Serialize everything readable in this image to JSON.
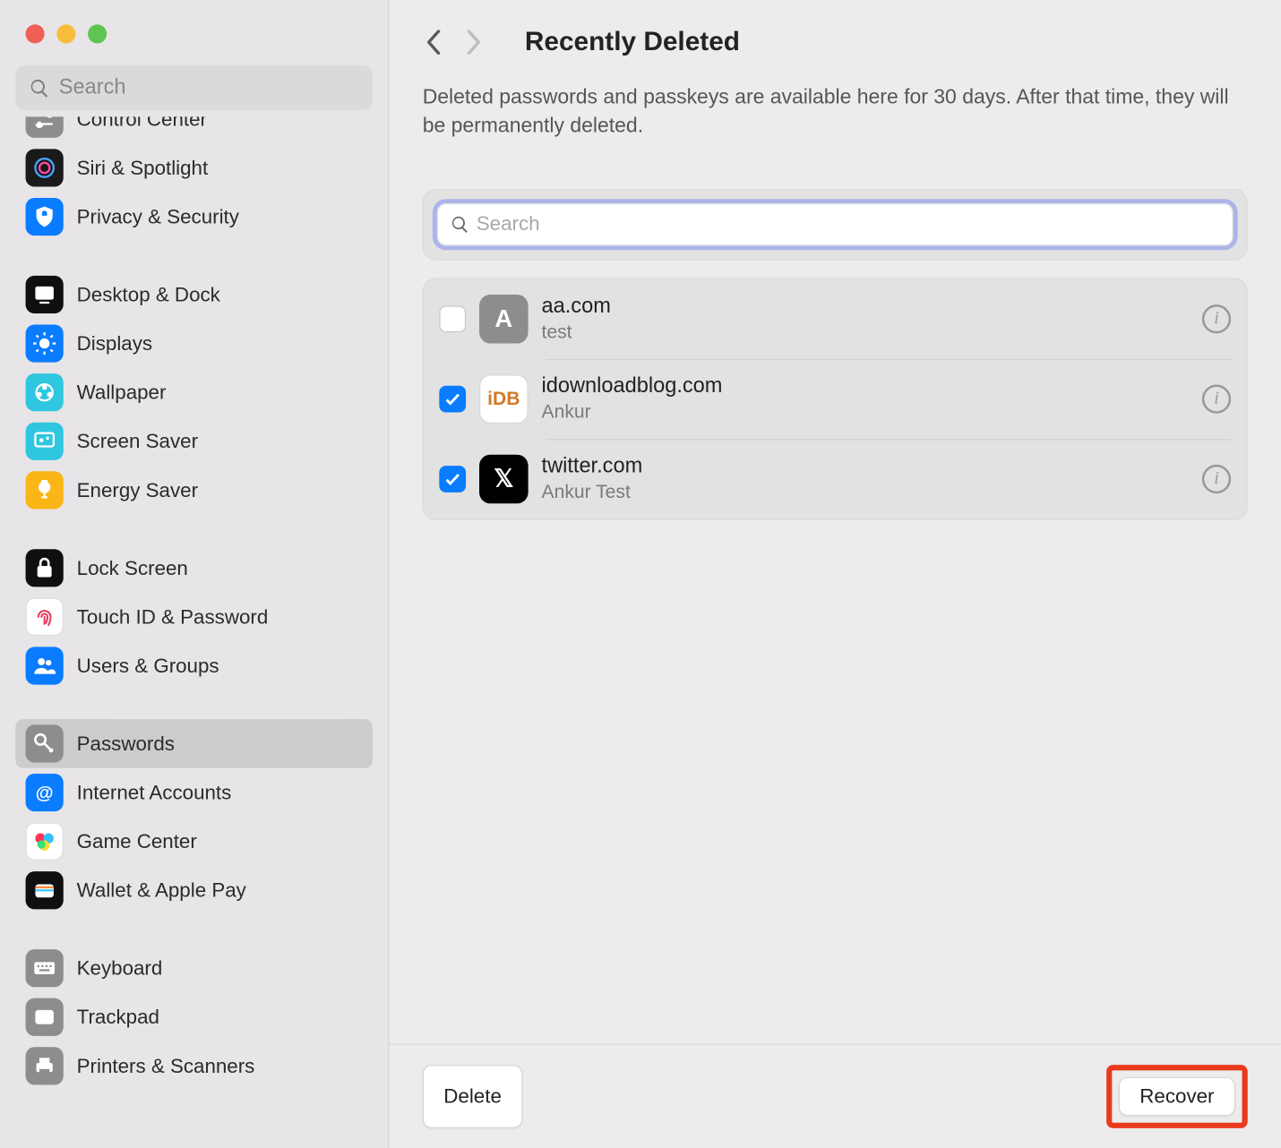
{
  "sidebar": {
    "search_placeholder": "Search",
    "items": [
      {
        "id": "control-center",
        "label": "Control Center",
        "bg": "#8d8d8d",
        "partial": true
      },
      {
        "id": "siri-spotlight",
        "label": "Siri & Spotlight",
        "bg": "#1a1a1a"
      },
      {
        "id": "privacy-security",
        "label": "Privacy & Security",
        "bg": "#0a7cff"
      },
      {
        "gap": true
      },
      {
        "id": "desktop-dock",
        "label": "Desktop & Dock",
        "bg": "#0f0f0f"
      },
      {
        "id": "displays",
        "label": "Displays",
        "bg": "#0a7cff"
      },
      {
        "id": "wallpaper",
        "label": "Wallpaper",
        "bg": "#2ec7df"
      },
      {
        "id": "screen-saver",
        "label": "Screen Saver",
        "bg": "#2ec7df"
      },
      {
        "id": "energy-saver",
        "label": "Energy Saver",
        "bg": "#fcb516"
      },
      {
        "gap": true
      },
      {
        "id": "lock-screen",
        "label": "Lock Screen",
        "bg": "#0f0f0f"
      },
      {
        "id": "touchid-password",
        "label": "Touch ID & Password",
        "bg": "#ffffff",
        "border": "#e0e0e0"
      },
      {
        "id": "users-groups",
        "label": "Users & Groups",
        "bg": "#0a7cff"
      },
      {
        "gap": true
      },
      {
        "id": "passwords",
        "label": "Passwords",
        "bg": "#8d8d8d",
        "selected": true
      },
      {
        "id": "internet-accounts",
        "label": "Internet Accounts",
        "bg": "#0a7cff"
      },
      {
        "id": "game-center",
        "label": "Game Center",
        "bg": "#ffffff",
        "border": "#e0e0e0"
      },
      {
        "id": "wallet-apple-pay",
        "label": "Wallet & Apple Pay",
        "bg": "#0f0f0f"
      },
      {
        "gap": true
      },
      {
        "id": "keyboard",
        "label": "Keyboard",
        "bg": "#8d8d8d"
      },
      {
        "id": "trackpad",
        "label": "Trackpad",
        "bg": "#8d8d8d"
      },
      {
        "id": "printers-scanners",
        "label": "Printers & Scanners",
        "bg": "#8d8d8d"
      }
    ]
  },
  "main": {
    "title": "Recently Deleted",
    "description": "Deleted passwords and passkeys are available here for 30 days. After that time, they will be permanently deleted.",
    "search_placeholder": "Search",
    "rows": [
      {
        "site": "aa.com",
        "user": "test",
        "checked": false,
        "icon_label": "A",
        "icon_bg": "#8d8d8d",
        "icon_fg": "#fff"
      },
      {
        "site": "idownloadblog.com",
        "user": "Ankur",
        "checked": true,
        "icon_label": "iDB",
        "icon_bg": "#ffffff",
        "icon_fg": "#d27a27",
        "icon_border": "#d9d9d9"
      },
      {
        "site": "twitter.com",
        "user": "Ankur Test",
        "checked": true,
        "icon_label": "𝕏",
        "icon_bg": "#000000",
        "icon_fg": "#fff"
      }
    ],
    "delete_label": "Delete",
    "recover_label": "Recover"
  }
}
